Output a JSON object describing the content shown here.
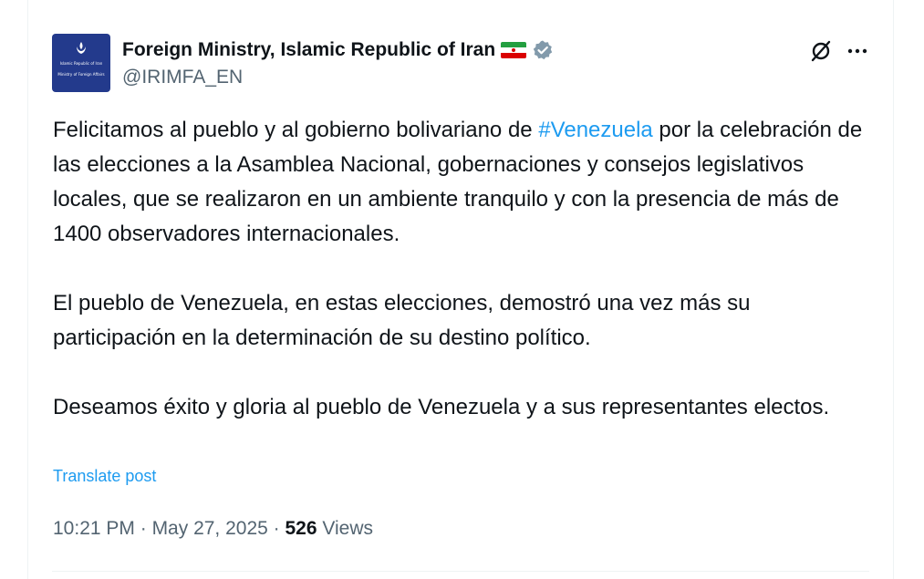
{
  "account": {
    "display_name": "Foreign Ministry, Islamic Republic of Iran",
    "flag_icon": "iran-flag-emoji",
    "verified_icon": "verified-badge-gray",
    "handle": "@IRIMFA_EN",
    "avatar": {
      "line1": "Islamic Republic of Iran",
      "line2": "Ministry of Foreign Affairs",
      "background": "#233a8c"
    }
  },
  "actions": {
    "grok_icon": "grok-icon",
    "more_icon": "more-dots-icon"
  },
  "post": {
    "p1_before": "Felicitamos al pueblo y al gobierno bolivariano de ",
    "p1_hashtag": "#Venezuela",
    "p1_after": " por la celebración de las elecciones a la Asamblea Nacional, gobernaciones y consejos legislativos locales, que se realizaron en un ambiente tranquilo y con la presencia de más de 1400 observadores internacionales.",
    "p2": "El pueblo de Venezuela, en estas elecciones, demostró una vez más su participación en la determinación de su destino político.",
    "p3": "Deseamos éxito y gloria al pueblo de Venezuela y a sus representantes electos.",
    "translate_label": "Translate post"
  },
  "meta": {
    "time": "10:21 PM",
    "separator": " · ",
    "date": "May 27, 2025",
    "views_count": "526",
    "views_label": "Views"
  },
  "colors": {
    "link": "#1d9bf0",
    "text": "#0f1419",
    "muted": "#536471"
  }
}
